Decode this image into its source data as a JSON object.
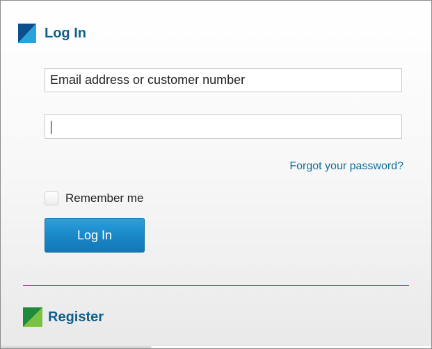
{
  "login": {
    "title": "Log In",
    "email_placeholder": "Email address or customer number",
    "email_value": "",
    "password_value": "",
    "forgot_label": "Forgot your password?",
    "remember_label": "Remember me",
    "remember_checked": false,
    "submit_label": "Log In"
  },
  "register": {
    "label": "Register"
  },
  "icons": {
    "login_logo": "blue-diagonal-square-icon",
    "register_logo": "green-diagonal-square-icon"
  },
  "colors": {
    "title": "#0f5f8a",
    "link": "#0f6f96",
    "button": "#1a86c6",
    "divider": "#2a8fb0",
    "login_logo_dark": "#0c4f8d",
    "login_logo_light": "#2aa3dd",
    "register_logo_dark": "#1f8a3b",
    "register_logo_light": "#7cc242"
  }
}
